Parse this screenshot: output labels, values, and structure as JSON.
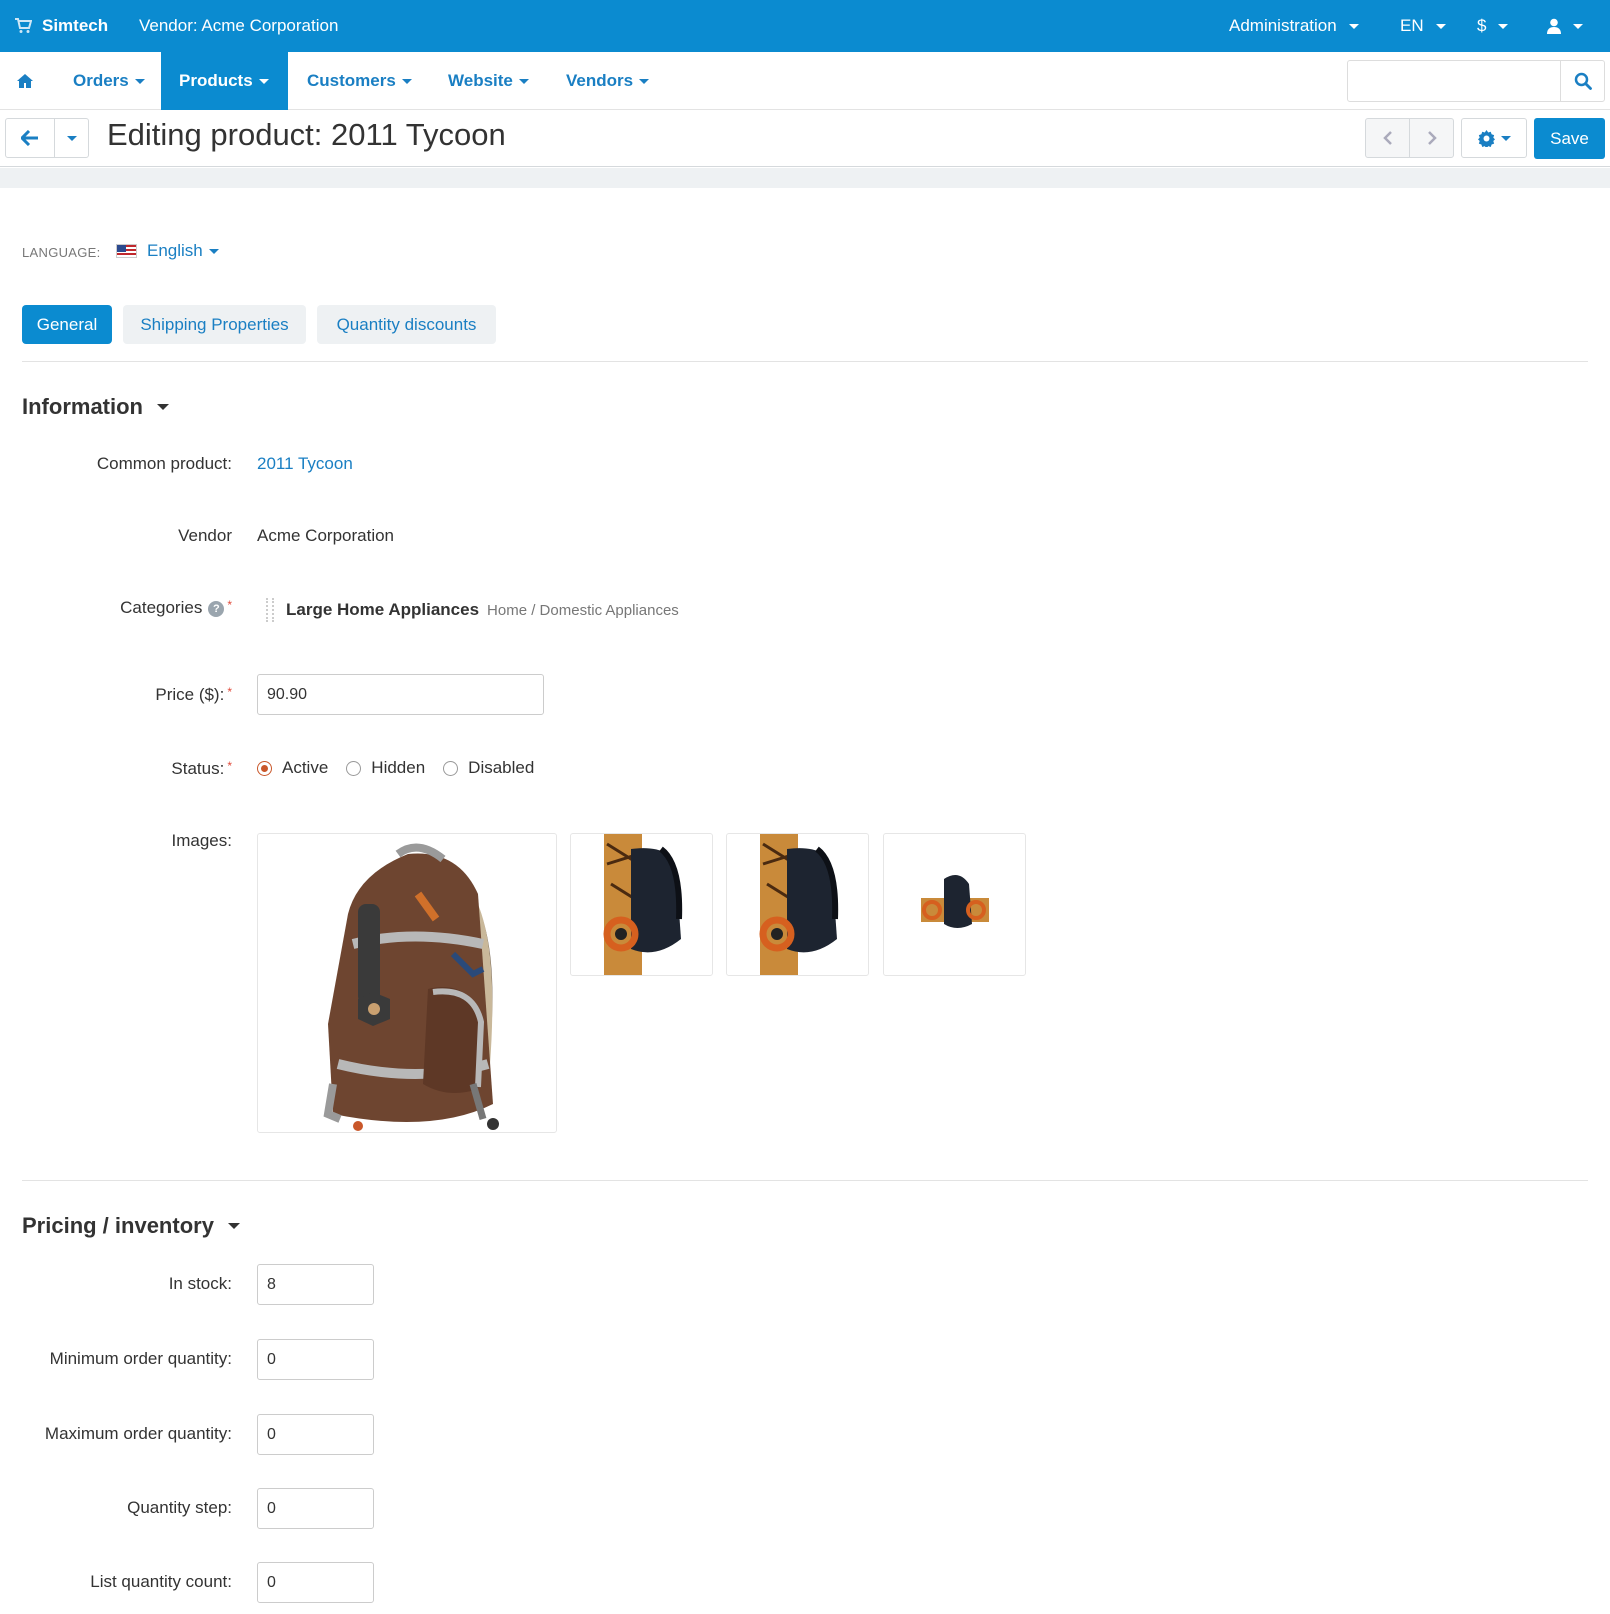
{
  "topbar": {
    "brand": "Simtech",
    "vendor": "Vendor: Acme Corporation",
    "administration": "Administration",
    "language": "EN",
    "currency": "$",
    "user_icon": "user-icon"
  },
  "nav": {
    "home_icon": "home-icon",
    "items": [
      {
        "label": "Orders"
      },
      {
        "label": "Products"
      },
      {
        "label": "Customers"
      },
      {
        "label": "Website"
      },
      {
        "label": "Vendors"
      }
    ],
    "search_placeholder": ""
  },
  "title": "Editing product: 2011 Tycoon",
  "save_label": "Save",
  "language": {
    "label": "LANGUAGE:",
    "value": "English"
  },
  "tabs": [
    "General",
    "Shipping Properties",
    "Quantity discounts"
  ],
  "information": {
    "title": "Information",
    "common_product_label": "Common product:",
    "common_product_value": "2011 Tycoon",
    "vendor_label": "Vendor",
    "vendor_value": "Acme Corporation",
    "categories_label": "Categories",
    "category_name": "Large Home Appliances",
    "category_path": "Home / Domestic Appliances",
    "price_label": "Price ($):",
    "price_value": "90.90",
    "status_label": "Status:",
    "status_options": [
      "Active",
      "Hidden",
      "Disabled"
    ],
    "status_selected": "Active",
    "images_label": "Images:"
  },
  "pricing": {
    "title": "Pricing / inventory",
    "fields": [
      {
        "label": "In stock:",
        "value": "8"
      },
      {
        "label": "Minimum order quantity:",
        "value": "0"
      },
      {
        "label": "Maximum order quantity:",
        "value": "0"
      },
      {
        "label": "Quantity step:",
        "value": "0"
      },
      {
        "label": "List quantity count:",
        "value": "0"
      }
    ]
  },
  "colors": {
    "primary": "#0b8bd0",
    "link": "#1a7fc3",
    "required": "#e04a3a",
    "radio_active": "#c9572a"
  }
}
